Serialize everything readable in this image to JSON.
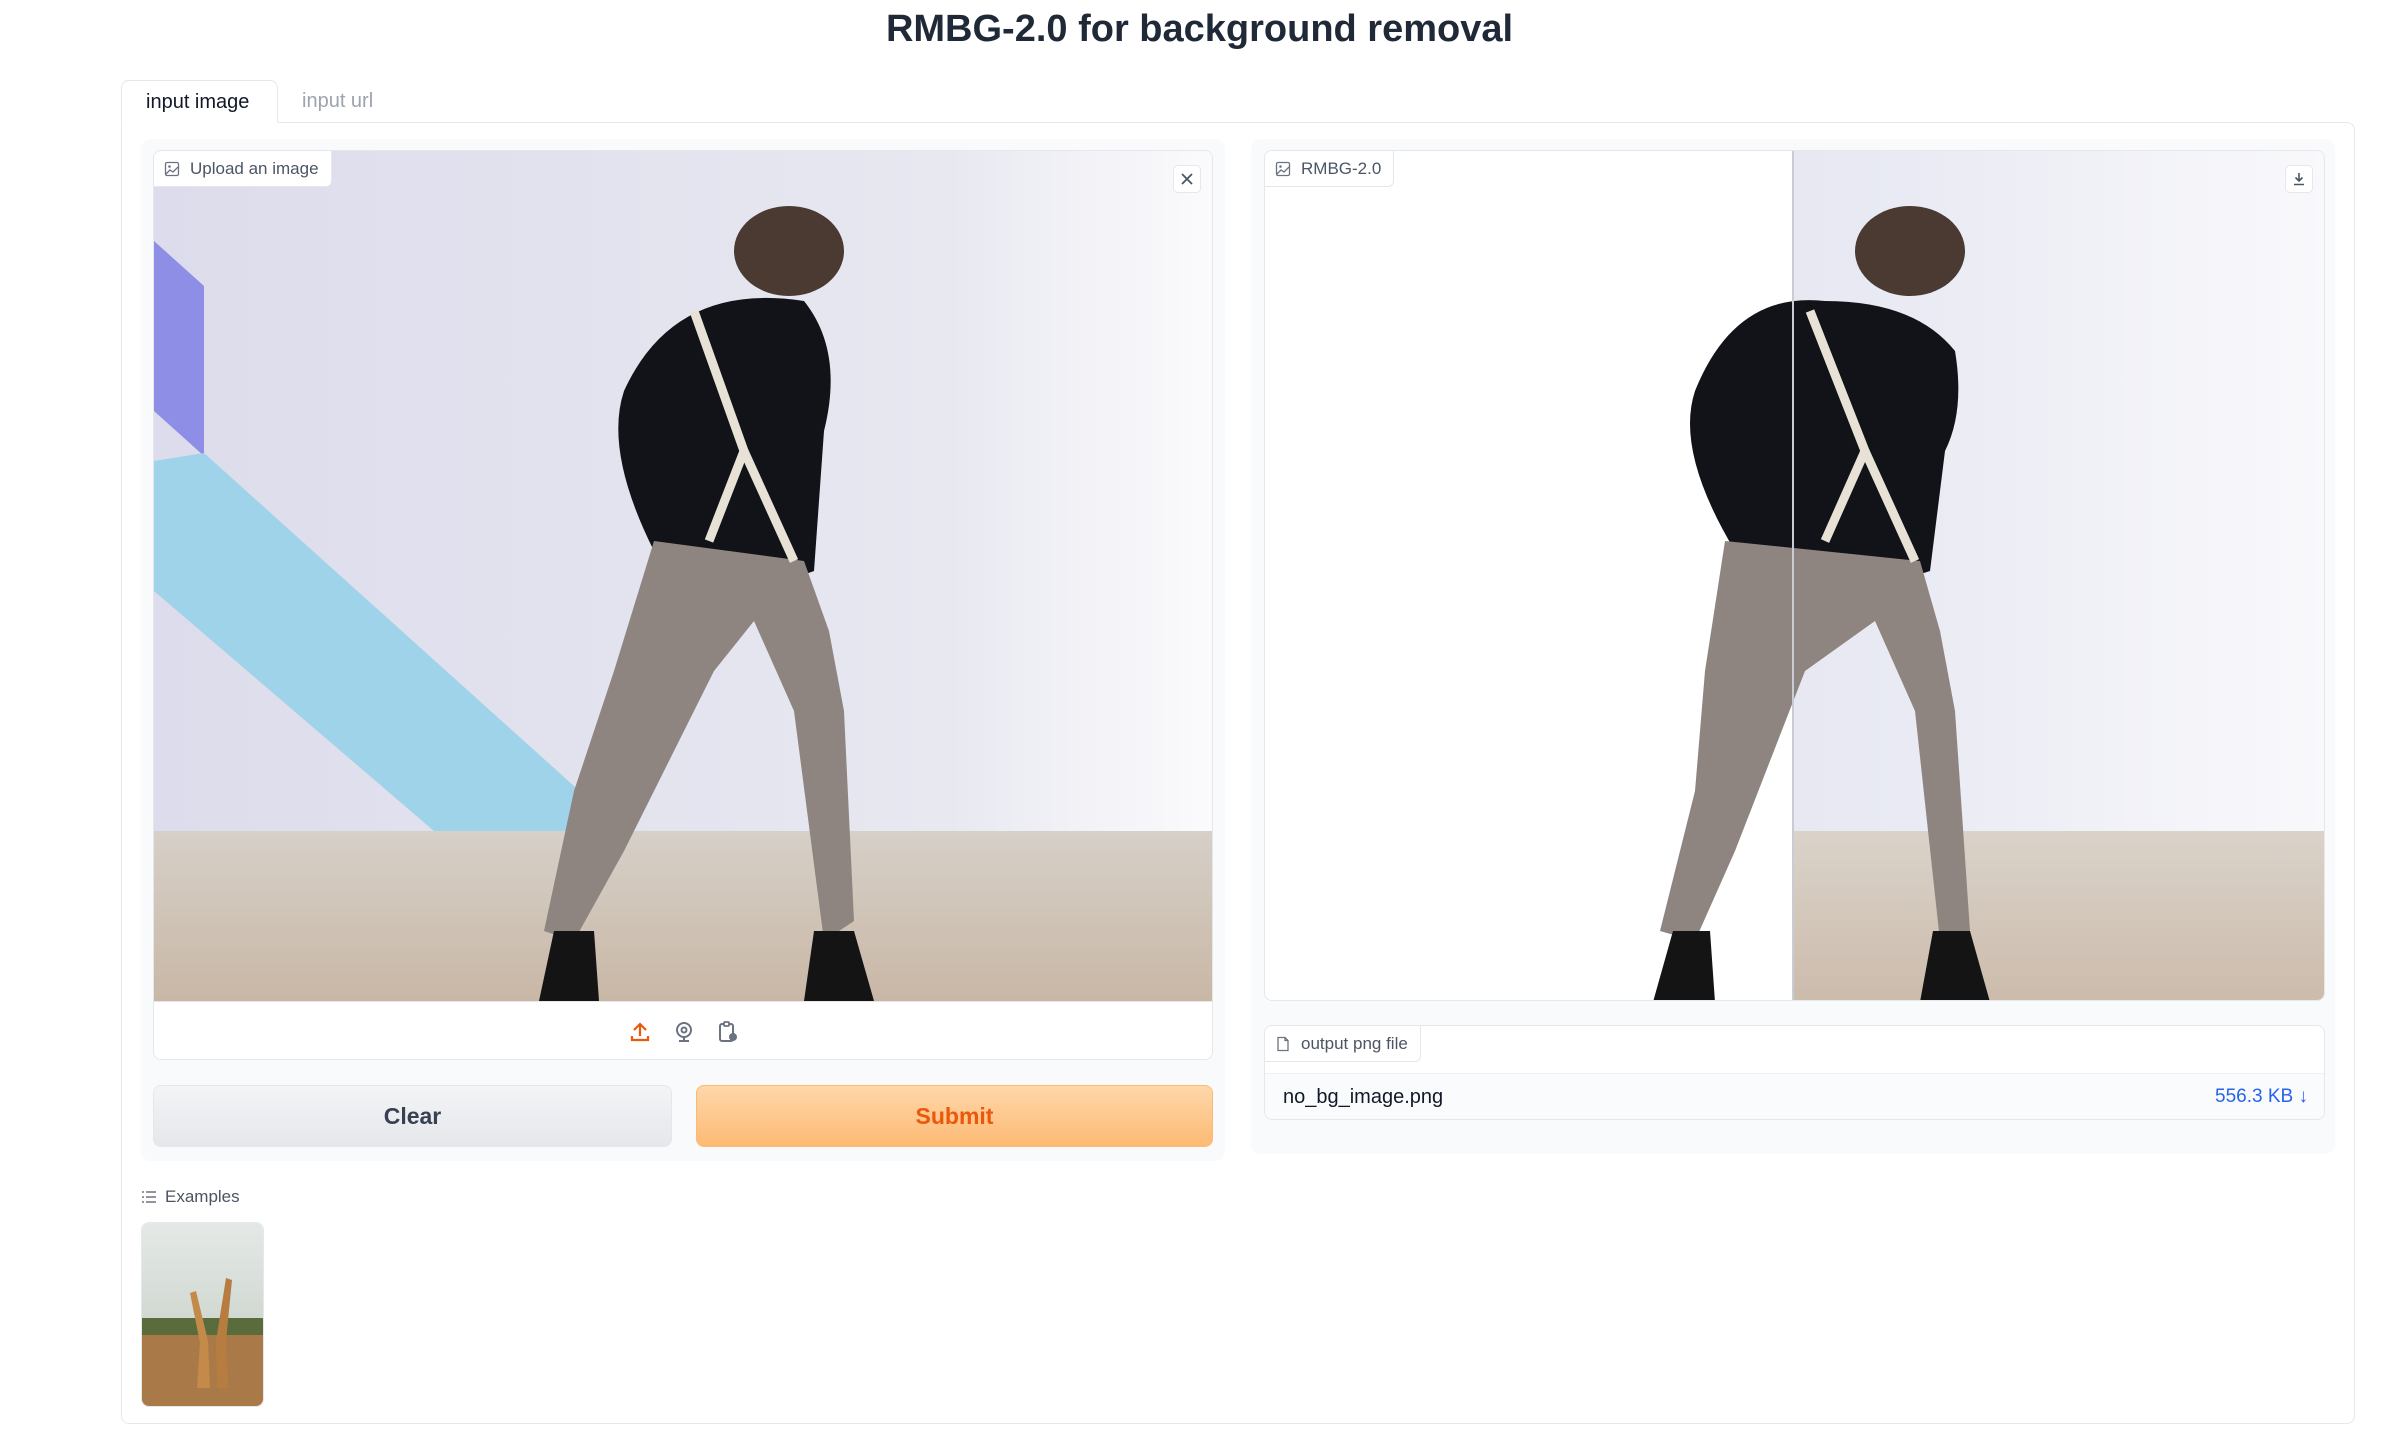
{
  "page": {
    "title": "RMBG-2.0 for background removal"
  },
  "tabs": [
    {
      "label": "input image",
      "active": true
    },
    {
      "label": "input url",
      "active": false
    }
  ],
  "input_block": {
    "label": "Upload an image",
    "label_icon": "image-icon",
    "clear_icon": "close-icon",
    "source_icons": [
      "upload-icon",
      "webcam-icon",
      "clipboard-icon"
    ]
  },
  "buttons": {
    "clear": "Clear",
    "submit": "Submit"
  },
  "output_block": {
    "label": "RMBG-2.0",
    "label_icon": "image-icon",
    "download_icon": "download-icon",
    "slider_position": 0.5
  },
  "file_block": {
    "label": "output png file",
    "label_icon": "file-icon",
    "filename": "no_bg_image.png",
    "size": "556.3 KB",
    "size_arrow": "↓"
  },
  "examples": {
    "label": "Examples",
    "label_icon": "list-icon"
  },
  "colors": {
    "accent": "#ea580c",
    "link": "#2563eb",
    "border": "#e5e7eb"
  }
}
